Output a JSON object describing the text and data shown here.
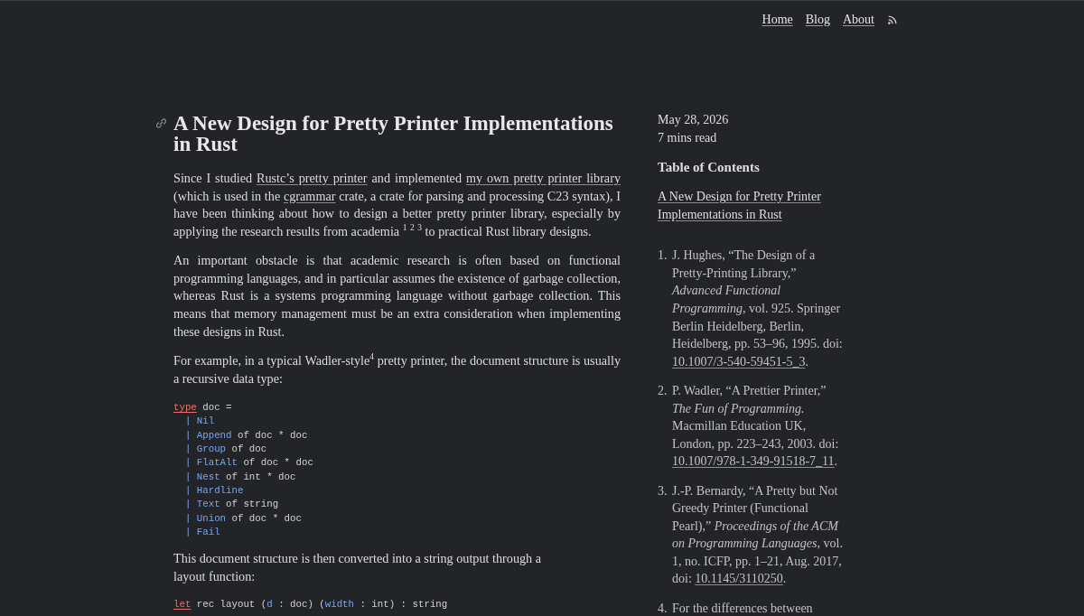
{
  "nav": {
    "links": [
      {
        "label": "Home"
      },
      {
        "label": "Blog"
      },
      {
        "label": "About"
      }
    ]
  },
  "article": {
    "title": "A New Design for Pretty Printer Implementations in Rust",
    "blocks": [
      {
        "kind": "paragraph",
        "runs": [
          {
            "kind": "text",
            "text": "Since I studied "
          },
          {
            "kind": "link",
            "text": "Rustc’s pretty printer"
          },
          {
            "kind": "text",
            "text": " and implemented "
          },
          {
            "kind": "link",
            "text": "my own pretty printer library"
          },
          {
            "kind": "text",
            "text": " (which is used in the "
          },
          {
            "kind": "link",
            "text": "cgrammar"
          },
          {
            "kind": "text",
            "text": " crate, a crate for parsing and processing C23 syntax), I have been thinking about how to design a better pretty printer library, especially by applying the research results from academia "
          },
          {
            "kind": "refs",
            "items": [
              "1",
              "2",
              "3"
            ]
          },
          {
            "kind": "text",
            "text": " to practical Rust library designs."
          }
        ]
      },
      {
        "kind": "paragraph",
        "runs": [
          {
            "kind": "text",
            "text": "An important obstacle is that academic research is often based on functional programming languages, and in particular assumes the existence of garbage collection, whereas Rust is a systems programming language without garbage collection. This means that memory management must be an extra consideration when implementing these designs in Rust."
          }
        ]
      },
      {
        "kind": "paragraph",
        "runs": [
          {
            "kind": "text",
            "text": "For example, in a typical Wadler-style"
          },
          {
            "kind": "refs",
            "items": [
              "4"
            ]
          },
          {
            "kind": "text",
            "text": " pretty printer, the document structure is usually a recursive data type:"
          }
        ]
      },
      {
        "kind": "code",
        "lines": [
          [
            {
              "kind": "keyword",
              "text": "type"
            },
            {
              "kind": "plain",
              "text": " doc ="
            }
          ],
          [
            {
              "kind": "accent",
              "text": "  | Nil"
            }
          ],
          [
            {
              "kind": "accent",
              "text": "  | Append"
            },
            {
              "kind": "plain",
              "text": " of doc * doc"
            }
          ],
          [
            {
              "kind": "accent",
              "text": "  | Group"
            },
            {
              "kind": "plain",
              "text": " of doc"
            }
          ],
          [
            {
              "kind": "accent",
              "text": "  | FlatAlt"
            },
            {
              "kind": "plain",
              "text": " of doc * doc"
            }
          ],
          [
            {
              "kind": "accent",
              "text": "  | Nest"
            },
            {
              "kind": "plain",
              "text": " of int * doc"
            }
          ],
          [
            {
              "kind": "accent",
              "text": "  | Hardline"
            }
          ],
          [
            {
              "kind": "accent",
              "text": "  | Text"
            },
            {
              "kind": "plain",
              "text": " of string"
            }
          ],
          [
            {
              "kind": "accent",
              "text": "  | Union"
            },
            {
              "kind": "plain",
              "text": " of doc * doc"
            }
          ],
          [
            {
              "kind": "accent",
              "text": "  | Fail"
            }
          ]
        ]
      },
      {
        "kind": "paragraph",
        "runs": [
          {
            "kind": "text",
            "text": "This document structure is then converted into a string output through a\nlayout function:"
          }
        ]
      },
      {
        "kind": "code",
        "lines": [
          [
            {
              "kind": "keyword",
              "text": "let"
            },
            {
              "kind": "plain",
              "text": " rec layout ("
            },
            {
              "kind": "accent",
              "text": "d"
            },
            {
              "kind": "plain",
              "text": " : doc) ("
            },
            {
              "kind": "accent",
              "text": "width"
            },
            {
              "kind": "plain",
              "text": " : int) : string"
            }
          ]
        ]
      }
    ]
  },
  "sidebar": {
    "date": "May 28, 2026",
    "reading_time": "7 mins read",
    "toc_title": "Table of Contents",
    "toc": [
      {
        "label": "A New Design for Pretty Printer Implementations in Rust"
      }
    ],
    "footnotes": [
      {
        "number": "1.",
        "runs": [
          {
            "kind": "text",
            "text": "J. Hughes, “The Design of a Pretty-Printing Library,” *Advanced Functional Programming*, vol. 925. Springer Berlin Heidelberg, Berlin, Heidelberg, pp. 53–96, 1995. doi: "
          },
          {
            "kind": "link",
            "text": "10.1007/3-540-59451-5_3"
          },
          {
            "kind": "text",
            "text": "."
          }
        ]
      },
      {
        "number": "2.",
        "runs": [
          {
            "kind": "text",
            "text": "P. Wadler, “A Prettier Printer,” *The Fun of Programming.* Macmillan Education UK, London, pp. 223–243, 2003. doi: "
          },
          {
            "kind": "link",
            "text": "10.1007/978-1-349-91518-7_11"
          },
          {
            "kind": "text",
            "text": "."
          }
        ]
      },
      {
        "number": "3.",
        "runs": [
          {
            "kind": "text",
            "text": "J.-P. Bernardy, “A Pretty but Not Greedy Printer (Functional Pearl),” *Proceedings of the ACM on Programming Languages*, vol. 1, no. ICFP, pp. 1–21, Aug. 2017, doi: "
          },
          {
            "kind": "link",
            "text": "10.1145/3110250"
          },
          {
            "kind": "text",
            "text": "."
          }
        ]
      },
      {
        "number": "4.",
        "runs": [
          {
            "kind": "text",
            "text": "For the differences between"
          }
        ]
      }
    ]
  }
}
